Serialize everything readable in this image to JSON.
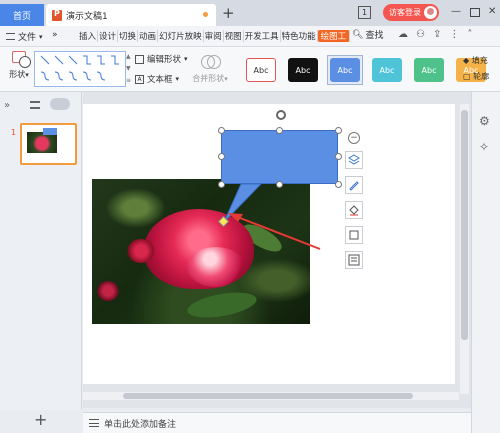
{
  "titlebar": {
    "home_tab": "首页",
    "doc_tab": "演示文稿1",
    "new_tab": "+",
    "page_indicator": "1",
    "login_label": "访客登录",
    "min": "—",
    "close": "✕"
  },
  "menubar": {
    "file_label": "文件",
    "more": "»",
    "items": [
      {
        "label": "插入",
        "active": false
      },
      {
        "label": "设计",
        "active": false
      },
      {
        "label": "切换",
        "active": false
      },
      {
        "label": "动画",
        "active": false
      },
      {
        "label": "幻灯片放映",
        "active": false
      },
      {
        "label": "审阅",
        "active": false
      },
      {
        "label": "视图",
        "active": false
      },
      {
        "label": "开发工具",
        "active": false
      },
      {
        "label": "特色功能",
        "active": false
      },
      {
        "label": "绘图工",
        "active": true
      }
    ],
    "search_label": "查找"
  },
  "ribbon": {
    "shape_label": "形状",
    "edit_shape_label": "编辑形状",
    "textbox_label": "文本框",
    "merge_label": "合并形状",
    "styles": [
      {
        "label": "Abc",
        "bg": "#ffffff",
        "fg": "#333333",
        "border": "#e05555"
      },
      {
        "label": "Abc",
        "bg": "#111111",
        "fg": "#ffffff",
        "border": "#111111"
      },
      {
        "label": "Abc",
        "bg": "#5b8fe3",
        "fg": "#ffffff",
        "border": "#5b8fe3"
      },
      {
        "label": "Abc",
        "bg": "#4fc3d8",
        "fg": "#ffffff",
        "border": "#4fc3d8"
      },
      {
        "label": "Abc",
        "bg": "#4ec28a",
        "fg": "#ffffff",
        "border": "#4ec28a"
      },
      {
        "label": "Abc",
        "bg": "#f4b248",
        "fg": "#ffffff",
        "border": "#f4b248"
      }
    ],
    "fill_label": "填充",
    "outline_label": "轮廓"
  },
  "slides_panel": {
    "slide_number": "1",
    "add_label": "+"
  },
  "notes": {
    "placeholder": "单击此处添加备注"
  },
  "colors": {
    "accent": "#f26522",
    "callout": "#5b8fe3",
    "arrow": "#e53935"
  }
}
